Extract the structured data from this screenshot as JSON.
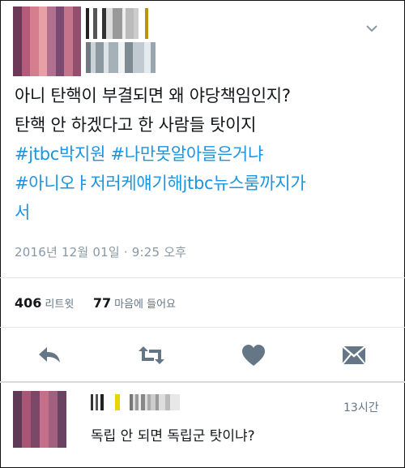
{
  "tweet": {
    "lines": [
      "아니 탄핵이 부결되면 왜 야당책임인지?",
      "탄핵 안 하겠다고 한 사람들 탓이지"
    ],
    "hashtags": [
      "#jtbc박지원",
      "#나만못알아들은거냐",
      "#아니오ㅑ저러케얘기해jtbc뉴스룸까지가",
      "서"
    ],
    "timestamp": "2016년 12월 01일 · 9:25 오후"
  },
  "stats": {
    "retweets": {
      "count": "406",
      "label": "리트윗"
    },
    "likes": {
      "count": "77",
      "label": "마음에 들어요"
    }
  },
  "actions": [
    "reply-icon",
    "retweet-icon",
    "heart-icon",
    "message-icon"
  ],
  "reply": {
    "time": "13시간",
    "text": "독립 안 되면 독립군 탓이냐?"
  },
  "colors": {
    "link": "#1b95e0",
    "icon": "#657786",
    "divider": "#e1e8ed"
  }
}
